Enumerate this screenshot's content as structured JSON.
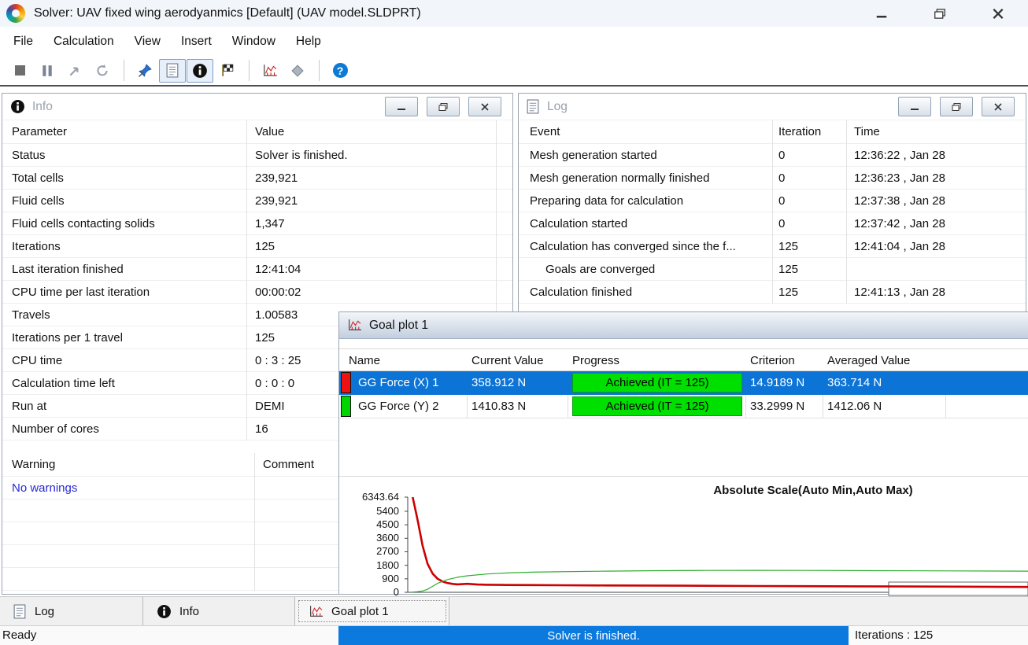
{
  "window": {
    "title": "Solver: UAV fixed wing aerodyanmics [Default] (UAV model.SLDPRT)",
    "icon": "flow-solver-icon"
  },
  "menu": {
    "items": [
      "File",
      "Calculation",
      "View",
      "Insert",
      "Window",
      "Help"
    ]
  },
  "toolbar": {
    "icons": [
      "stop-icon",
      "pause-icon",
      "resume-icon",
      "refresh-icon",
      "pin-icon",
      "log-list-icon",
      "info-icon",
      "finish-flag-icon",
      "goal-plot-icon",
      "preview-diamond-icon",
      "help-icon"
    ]
  },
  "info_panel": {
    "title": "Info",
    "columns": {
      "parameter": "Parameter",
      "value": "Value"
    },
    "rows": [
      {
        "parameter": "Status",
        "value": "Solver is finished."
      },
      {
        "parameter": "Total cells",
        "value": "239,921"
      },
      {
        "parameter": "Fluid cells",
        "value": "239,921"
      },
      {
        "parameter": "Fluid cells contacting solids",
        "value": "1,347"
      },
      {
        "parameter": "Iterations",
        "value": "125"
      },
      {
        "parameter": "Last iteration finished",
        "value": "12:41:04"
      },
      {
        "parameter": "CPU time per last iteration",
        "value": "00:00:02"
      },
      {
        "parameter": "Travels",
        "value": "1.00583"
      },
      {
        "parameter": "Iterations per 1 travel",
        "value": "125"
      },
      {
        "parameter": "CPU time",
        "value": "0 : 3 : 25"
      },
      {
        "parameter": "Calculation time left",
        "value": "0 : 0 : 0"
      },
      {
        "parameter": "Run at",
        "value": "DEMI"
      },
      {
        "parameter": "Number of cores",
        "value": "16"
      }
    ],
    "warnings": {
      "columns": {
        "warning": "Warning",
        "comment": "Comment"
      },
      "message": "No warnings",
      "comment": ""
    }
  },
  "log_panel": {
    "title": "Log",
    "columns": {
      "event": "Event",
      "iteration": "Iteration",
      "time": "Time"
    },
    "rows": [
      {
        "event": "Mesh generation started",
        "iteration": "0",
        "time": "12:36:22 , Jan 28"
      },
      {
        "event": "Mesh generation normally finished",
        "iteration": "0",
        "time": "12:36:23 , Jan 28"
      },
      {
        "event": "Preparing data for calculation",
        "iteration": "0",
        "time": "12:37:38 , Jan 28"
      },
      {
        "event": "Calculation started",
        "iteration": "0",
        "time": "12:37:42 , Jan 28"
      },
      {
        "event": "Calculation has converged since the f...",
        "iteration": "125",
        "time": "12:41:04 , Jan 28"
      },
      {
        "event": "Goals are converged",
        "iteration": "125",
        "time": ""
      },
      {
        "event": "Calculation finished",
        "iteration": "125",
        "time": "12:41:13 , Jan 28"
      }
    ]
  },
  "goal_plot": {
    "title": "Goal plot 1",
    "columns": {
      "name": "Name",
      "current": "Current Value",
      "progress": "Progress",
      "criterion": "Criterion",
      "averaged": "Averaged Value"
    },
    "rows": [
      {
        "name": "GG Force (X) 1",
        "swatch": "#ee1111",
        "current": "358.912 N",
        "progress": "Achieved (IT = 125)",
        "criterion": "14.9189 N",
        "averaged": "363.714 N",
        "selected": true
      },
      {
        "name": "GG Force (Y) 2",
        "swatch": "#00d400",
        "current": "1410.83 N",
        "progress": "Achieved (IT = 125)",
        "criterion": "33.2999 N",
        "averaged": "1412.06 N",
        "selected": false
      }
    ],
    "progress_color": "#00e000",
    "selection_color": "#0b74d6"
  },
  "chart_data": {
    "type": "line",
    "title": "Absolute Scale(Auto Min,Auto Max)",
    "xlabel": "",
    "ylabel": "",
    "xlim": [
      0,
      125
    ],
    "ylim": [
      0,
      6343.64
    ],
    "y_ticks": [
      0,
      900,
      1800,
      2700,
      3600,
      4500,
      5400,
      6343.64
    ],
    "y_tick_labels": [
      "0",
      "900",
      "1800",
      "2700",
      "3600",
      "4500",
      "5400",
      "6343.64"
    ],
    "grid": false,
    "legend": "none",
    "series": [
      {
        "name": "GG Force (X) 1",
        "color": "#cc0000",
        "stroke_width": 2.6,
        "x": [
          1,
          2,
          3,
          4,
          5,
          6,
          7,
          8,
          9,
          10,
          12,
          14,
          16,
          20,
          25,
          30,
          40,
          55,
          70,
          90,
          110,
          125
        ],
        "y": [
          6343,
          4800,
          3100,
          1900,
          1250,
          900,
          720,
          620,
          560,
          530,
          565,
          520,
          505,
          490,
          480,
          472,
          458,
          440,
          420,
          398,
          377,
          359
        ]
      },
      {
        "name": "GG Force (Y) 2",
        "color": "#2fae2f",
        "stroke_width": 1.2,
        "x": [
          1,
          2,
          3,
          4,
          5,
          6,
          8,
          10,
          12,
          16,
          20,
          25,
          30,
          40,
          50,
          60,
          70,
          80,
          95,
          110,
          125
        ],
        "y": [
          15,
          40,
          90,
          200,
          400,
          600,
          850,
          1000,
          1100,
          1220,
          1290,
          1340,
          1370,
          1410,
          1440,
          1455,
          1462,
          1456,
          1440,
          1425,
          1412
        ]
      }
    ]
  },
  "tabbar": {
    "tabs": [
      {
        "label": "Log",
        "icon": "log-list-icon",
        "active": false
      },
      {
        "label": "Info",
        "icon": "info-icon",
        "active": false
      },
      {
        "label": "Goal plot 1",
        "icon": "goal-plot-icon",
        "active": true
      }
    ]
  },
  "statusbar": {
    "left": "Ready",
    "message": "Solver is finished.",
    "right": "Iterations : 125"
  }
}
